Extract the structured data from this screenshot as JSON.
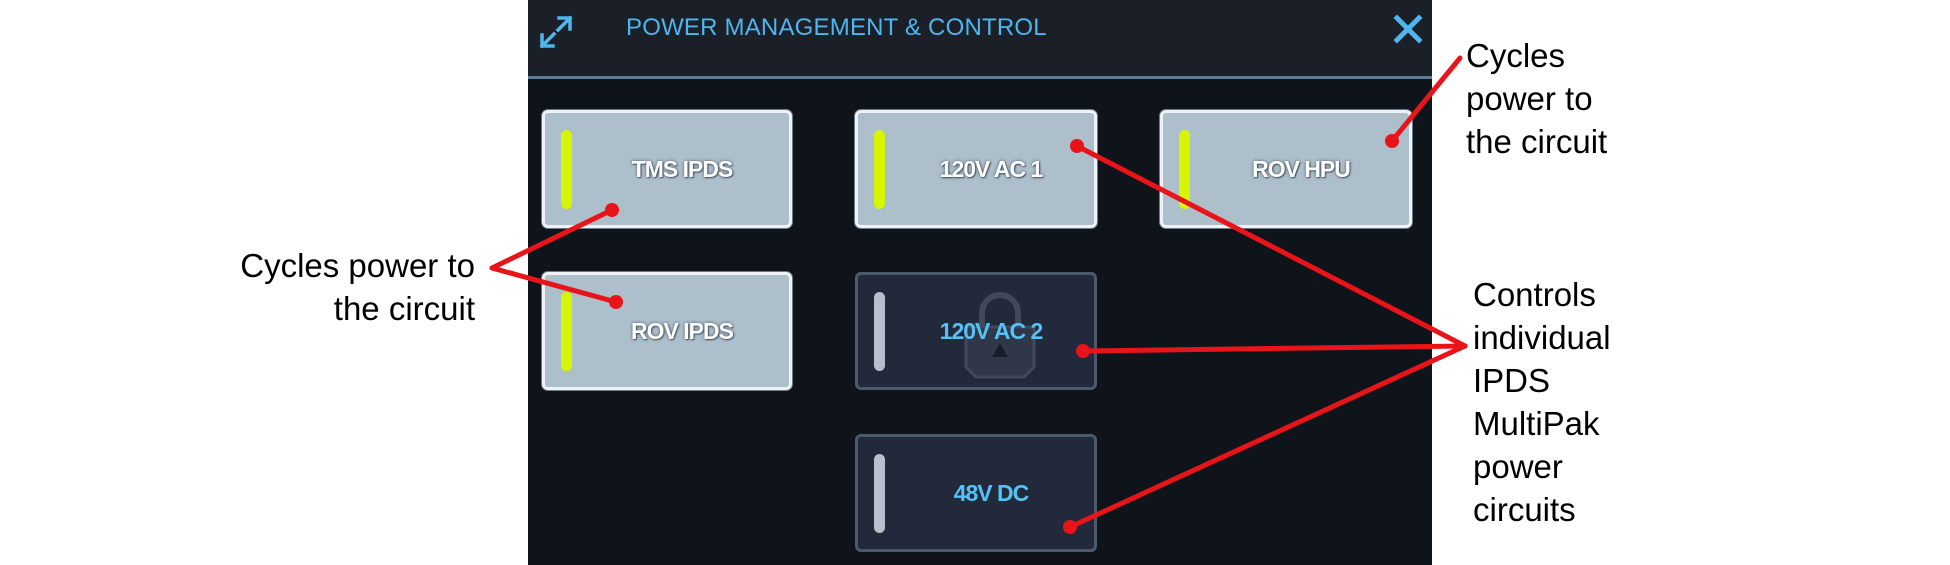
{
  "panel": {
    "title": "POWER MANAGEMENT & CONTROL",
    "expand_icon": "expand-arrows-icon",
    "close_icon": "close-x-icon",
    "colors": {
      "background": "#0f131a",
      "header": "#1b1f27",
      "title": "#4fb5ee",
      "indicator_on": "#d6f500",
      "indicator_off": "#b6c0ca"
    }
  },
  "buttons": {
    "tms_ipds": {
      "label": "TMS IPDS",
      "state": "on"
    },
    "ac1": {
      "label": "120V AC 1",
      "state": "on"
    },
    "rov_hpu": {
      "label": "ROV HPU",
      "state": "on"
    },
    "rov_ipds": {
      "label": "ROV IPDS",
      "state": "on"
    },
    "ac2": {
      "label": "120V AC 2",
      "state": "off",
      "locked": true,
      "lock_icon": "padlock-icon"
    },
    "dc48": {
      "label": "48V DC",
      "state": "off"
    }
  },
  "annotations": {
    "left": {
      "line1": "Cycles power to",
      "line2": "the circuit"
    },
    "top_right": {
      "lines": [
        "Cycles",
        "power to",
        "the circuit"
      ]
    },
    "right": {
      "lines": [
        "Controls",
        "individual",
        "IPDS",
        "MultiPak",
        "power",
        "circuits"
      ]
    },
    "callout_color": "#e8141a"
  }
}
